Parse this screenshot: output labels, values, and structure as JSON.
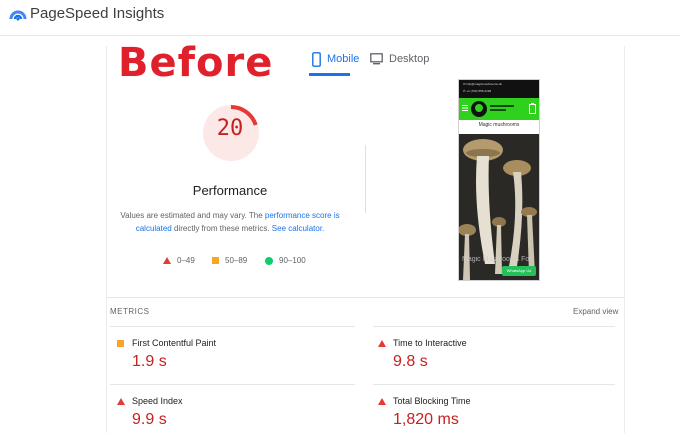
{
  "app": {
    "title": "PageSpeed Insights"
  },
  "overlay": {
    "before_label": "Before"
  },
  "tabs": [
    {
      "label": "Mobile",
      "active": true,
      "icon": "phone-icon"
    },
    {
      "label": "Desktop",
      "active": false,
      "icon": "monitor-icon"
    }
  ],
  "score": {
    "value": "20",
    "fraction": 0.2,
    "label": "Performance",
    "note_prefix": "Values are estimated and may vary. The ",
    "note_link1": "performance score is calculated",
    "note_mid": " directly from these metrics. ",
    "note_link2": "See calculator."
  },
  "legend": [
    {
      "range": "0–49",
      "shape": "triangle",
      "color": "#e53935"
    },
    {
      "range": "50–89",
      "shape": "square",
      "color": "#f6a623"
    },
    {
      "range": "90–100",
      "shape": "circle",
      "color": "#0cce6b"
    }
  ],
  "screenshot": {
    "header_line1": "✉ info@magicmushrooms.uk",
    "header_line2": "✆ +1 (760) 555-0196",
    "page_title": "Magic mushrooms",
    "overlay_caption": "Magic Mushrooms For",
    "whatsapp_label": "WhatsApp Us"
  },
  "metrics": {
    "section_label": "METRICS",
    "expand_label": "Expand view",
    "items": [
      {
        "label": "First Contentful Paint",
        "value": "1.9 s",
        "status": "average"
      },
      {
        "label": "Time to Interactive",
        "value": "9.8 s",
        "status": "fail"
      },
      {
        "label": "Speed Index",
        "value": "9.9 s",
        "status": "fail"
      },
      {
        "label": "Total Blocking Time",
        "value": "1,820 ms",
        "status": "fail"
      }
    ]
  },
  "colors": {
    "accent": "#1a73e8",
    "fail": "#e53935",
    "average": "#f6a623",
    "pass": "#0cce6b",
    "before_red": "#e0202a"
  }
}
